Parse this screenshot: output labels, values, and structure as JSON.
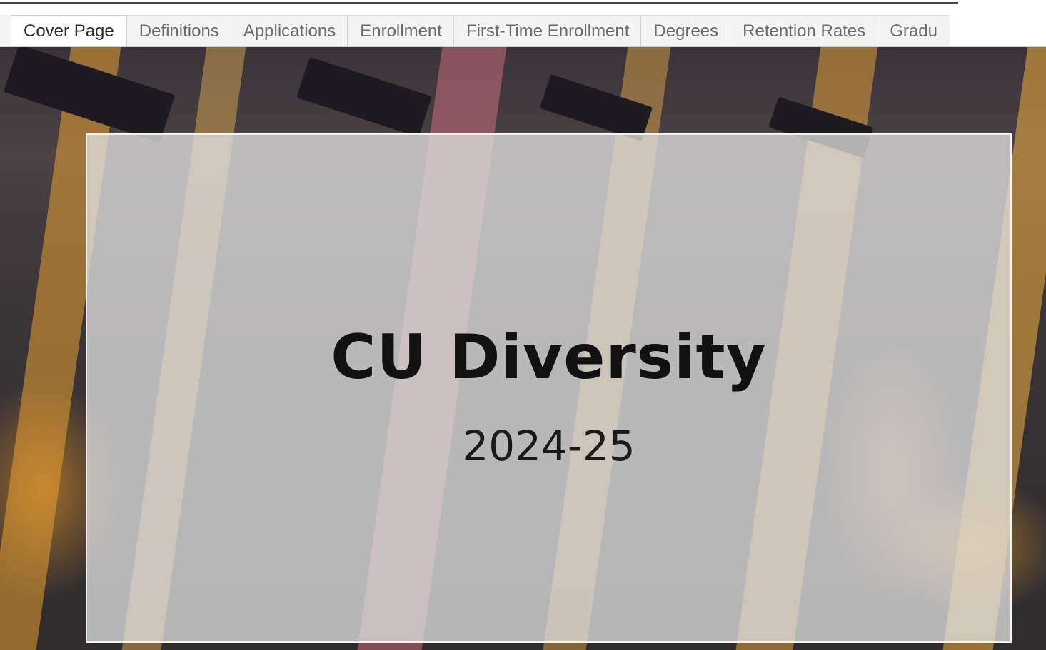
{
  "tabs": [
    {
      "label": "Cover Page",
      "active": true
    },
    {
      "label": "Definitions",
      "active": false
    },
    {
      "label": "Applications",
      "active": false
    },
    {
      "label": "Enrollment",
      "active": false
    },
    {
      "label": "First-Time Enrollment",
      "active": false
    },
    {
      "label": "Degrees",
      "active": false
    },
    {
      "label": "Retention Rates",
      "active": false
    },
    {
      "label": "Gradu",
      "active": false
    }
  ],
  "cover": {
    "title": "CU Diversity",
    "subtitle": "2024-25"
  },
  "colors": {
    "panel_overlay": "#e2e2e2",
    "gown_gold": "#e8a43a",
    "tassel_orange": "#e0703a"
  }
}
